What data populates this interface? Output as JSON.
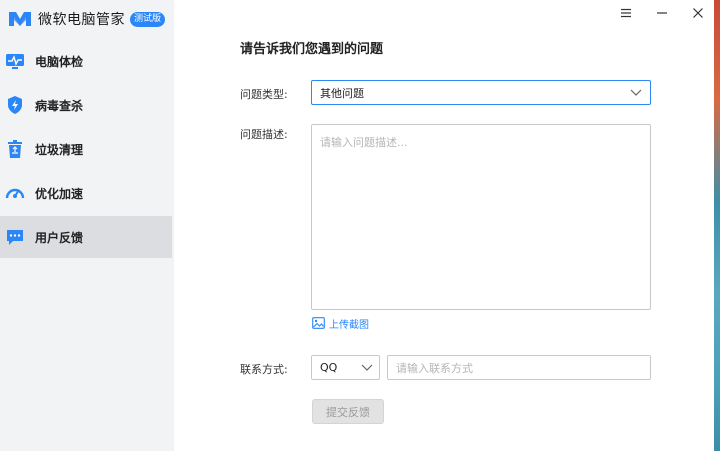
{
  "app": {
    "name": "微软电脑管家",
    "badge": "测试版"
  },
  "sidebar": {
    "items": [
      {
        "label": "电脑体检",
        "icon": "pc-checkup-icon",
        "active": false
      },
      {
        "label": "病毒查杀",
        "icon": "shield-icon",
        "active": false
      },
      {
        "label": "垃圾清理",
        "icon": "trash-icon",
        "active": false
      },
      {
        "label": "优化加速",
        "icon": "speedometer-icon",
        "active": false
      },
      {
        "label": "用户反馈",
        "icon": "chat-bubble-icon",
        "active": true
      }
    ]
  },
  "window_controls": [
    "menu-icon",
    "minimize-icon",
    "close-icon"
  ],
  "feedback": {
    "title": "请告诉我们您遇到的问题",
    "type_label": "问题类型:",
    "type_value": "其他问题",
    "desc_label": "问题描述:",
    "desc_placeholder": "请输入问题描述...",
    "upload_label": "上传截图",
    "contact_label": "联系方式:",
    "contact_type": "QQ",
    "contact_placeholder": "请输入联系方式",
    "submit_label": "提交反馈"
  },
  "colors": {
    "accent": "#2b86f7",
    "sidebar_bg": "#f2f3f5",
    "active_item_bg": "#dcdde0"
  }
}
